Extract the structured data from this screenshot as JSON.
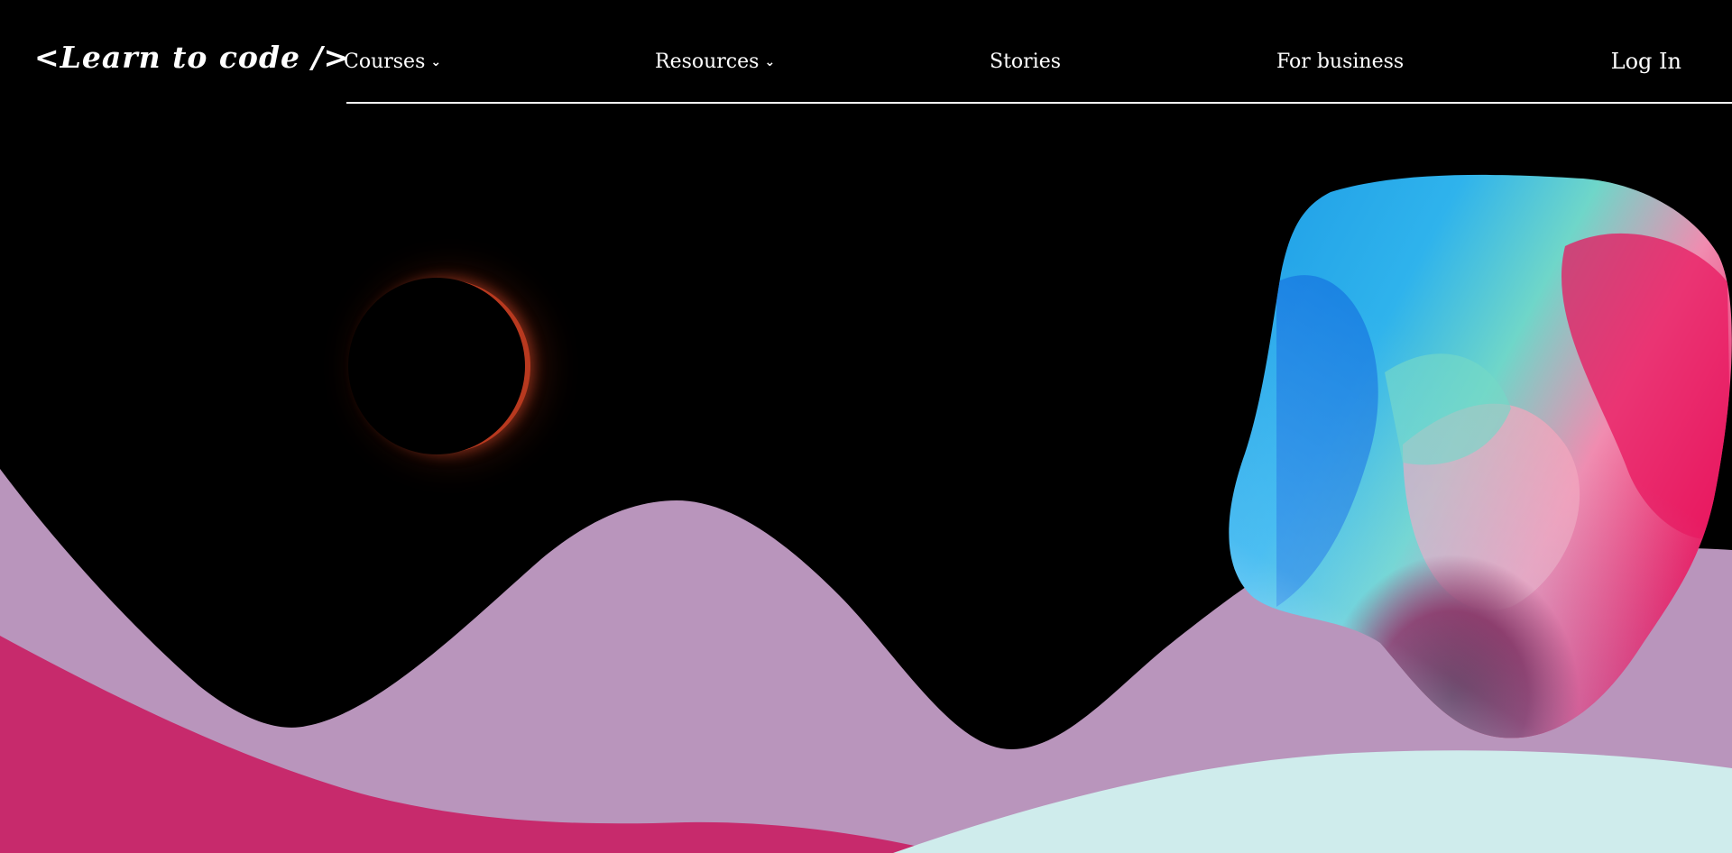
{
  "header": {
    "logo": "<Learn to code />",
    "nav": [
      {
        "label": "Courses",
        "has_dropdown": true
      },
      {
        "label": "Resources",
        "has_dropdown": true
      },
      {
        "label": "Stories",
        "has_dropdown": false
      },
      {
        "label": "For business",
        "has_dropdown": false
      }
    ],
    "login": "Log In"
  },
  "icons": {
    "dropdown": "chevron-down-icon"
  },
  "colors": {
    "background": "#000000",
    "mauve_hill": "#b995bc",
    "magenta_hill": "#c72a6c",
    "pale_hill": "#cfecec",
    "eclipse_ring": "#b8391f"
  }
}
